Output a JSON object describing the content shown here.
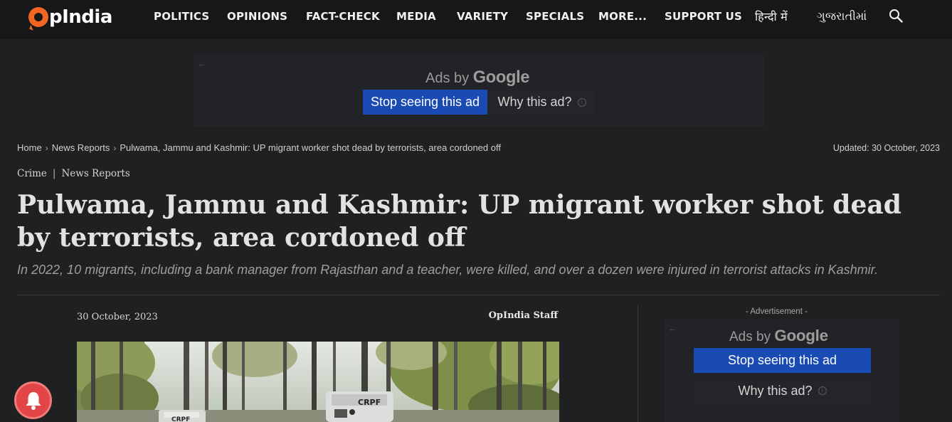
{
  "header": {
    "logo_text": "pIndia",
    "nav": [
      {
        "label": "POLITICS"
      },
      {
        "label": "OPINIONS"
      },
      {
        "label": "FACT-CHECK"
      },
      {
        "label": "MEDIA"
      },
      {
        "label": "VARIETY"
      },
      {
        "label": "SPECIALS"
      },
      {
        "label": "MORE..."
      },
      {
        "label": "SUPPORT US"
      },
      {
        "label": "हिन्दी में"
      },
      {
        "label": "ગુજરાતીમાં"
      }
    ],
    "search_icon": "search-icon"
  },
  "top_ad": {
    "ads_by": "Ads by",
    "google": "Google",
    "stop_label": "Stop seeing this ad",
    "why_label": "Why this ad?"
  },
  "breadcrumb": {
    "home": "Home",
    "section": "News Reports",
    "current": "Pulwama, Jammu and Kashmir: UP migrant worker shot dead by terrorists, area cordoned off",
    "updated": "Updated: 30 October, 2023"
  },
  "categories": [
    "Crime",
    "News Reports"
  ],
  "article": {
    "headline": "Pulwama, Jammu and Kashmir: UP migrant worker shot dead by terrorists, area cordoned off",
    "subheadline": "In 2022, 10 migrants, including a bank manager from Rajasthan and a teacher, were killed, and over a dozen were injured in terrorist attacks in Kashmir.",
    "date": "30 October, 2023",
    "author": "OpIndia Staff",
    "photo_vehicle_labels": [
      "CRPF",
      "CRPF"
    ]
  },
  "side_ad": {
    "label": "- Advertisement -",
    "ads_by": "Ads by",
    "google": "Google",
    "stop_label": "Stop seeing this ad",
    "why_label": "Why this ad?"
  },
  "colors": {
    "background": "#1f2022",
    "header": "#161719",
    "brand_orange": "#f26522",
    "ad_button_blue": "#1a4bb5",
    "notification_red": "#e24545"
  }
}
